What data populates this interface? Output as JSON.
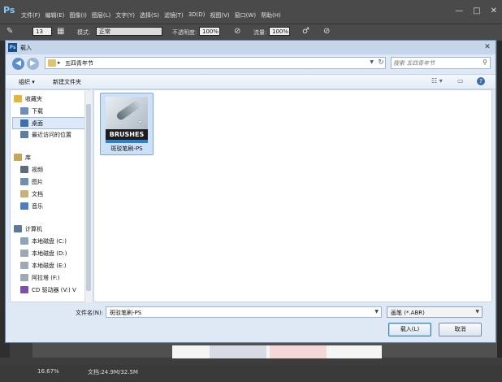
{
  "ps": {
    "logo": "Ps",
    "menu": [
      "文件(F)",
      "编辑(E)",
      "图像(I)",
      "图层(L)",
      "文字(Y)",
      "选择(S)",
      "滤镜(T)",
      "3D(D)",
      "视图(V)",
      "窗口(W)",
      "帮助(H)"
    ],
    "window_buttons": [
      "—",
      "□",
      "✕"
    ],
    "options": {
      "brush_size": "13",
      "mode_label": "模式:",
      "mode_value": "正常",
      "opacity_label": "不透明度:",
      "opacity_value": "100%",
      "flow_label": "流量:",
      "flow_value": "100%"
    },
    "status": {
      "zoom": "16.67%",
      "doc_info": "文档:24.9M/32.5M"
    }
  },
  "dialog": {
    "icon": "Ps",
    "title": "载入",
    "close_label": "✕",
    "back_label": "◀",
    "forward_label": "▶",
    "path_separator": "▸",
    "path_folder": "五四青年节",
    "path_dropdown": "▼",
    "refresh_label": "↻",
    "search_placeholder": "搜索 五四青年节",
    "search_icon": "⚲",
    "toolbar": {
      "organize": "组织 ▾",
      "new_folder": "新建文件夹",
      "view_icon": "☷ ▾",
      "pane_icon": "▭",
      "help_icon": "?"
    },
    "nav": [
      {
        "label": "收藏夹",
        "icon": "star-icon",
        "color": "#e6b53a",
        "group": true
      },
      {
        "label": "下载",
        "icon": "download-folder-icon",
        "color": "#6b8fb8"
      },
      {
        "label": "桌面",
        "icon": "desktop-icon",
        "color": "#3d6fae",
        "selected": true
      },
      {
        "label": "最近访问的位置",
        "icon": "recent-places-icon",
        "color": "#5c7da6"
      },
      {
        "label": "库",
        "icon": "library-icon",
        "color": "#c9a55a",
        "group": true
      },
      {
        "label": "视频",
        "icon": "video-library-icon",
        "color": "#5b6c80"
      },
      {
        "label": "图片",
        "icon": "pictures-library-icon",
        "color": "#6d8fb5"
      },
      {
        "label": "文档",
        "icon": "documents-library-icon",
        "color": "#c8b27b"
      },
      {
        "label": "音乐",
        "icon": "music-library-icon",
        "color": "#4c7fc1"
      },
      {
        "label": "计算机",
        "icon": "computer-icon",
        "color": "#5d7898",
        "group": true
      },
      {
        "label": "本地磁盘 (C:)",
        "icon": "drive-c-icon",
        "color": "#8ea4bb"
      },
      {
        "label": "本地磁盘 (D:)",
        "icon": "drive-d-icon",
        "color": "#9ea9b4"
      },
      {
        "label": "本地磁盘 (E:)",
        "icon": "drive-e-icon",
        "color": "#9ea9b4"
      },
      {
        "label": "阿拉塔 (F:)",
        "icon": "drive-f-icon",
        "color": "#9ea9b4"
      },
      {
        "label": "CD 驱动器 (V:) V",
        "icon": "cd-drive-icon",
        "color": "#7a4fae"
      }
    ],
    "files": [
      {
        "name": "斑驳笔刷-PS",
        "thumb_label": "BRUSHES",
        "cursor": "↖"
      }
    ],
    "filename_label": "文件名(N):",
    "filename_value": "斑驳笔刷-PS",
    "filetype_value": "画笔 (*.ABR)",
    "dropdown_arrow": "▼",
    "buttons": {
      "load": "载入(L)",
      "cancel": "取消"
    }
  }
}
